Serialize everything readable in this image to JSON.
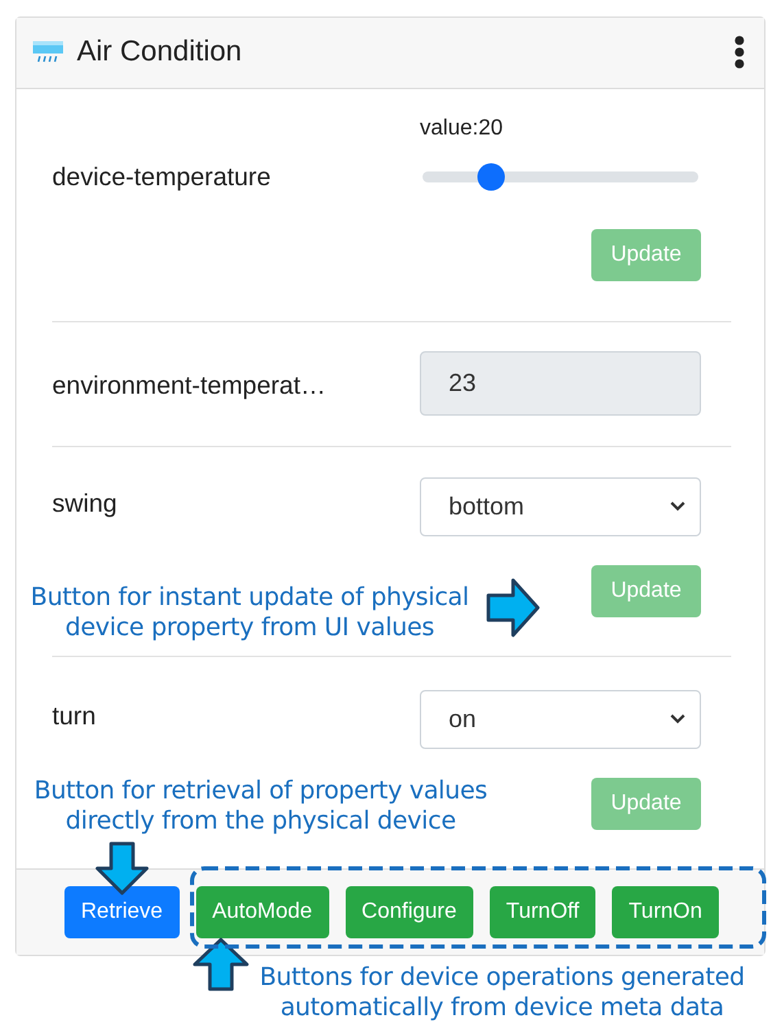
{
  "card": {
    "title": "Air Condition"
  },
  "properties": [
    {
      "kind": "slider",
      "label": "device-temperature",
      "reading": "value:20",
      "level": 0.22,
      "update": {
        "label": "Update",
        "disabled": true
      }
    },
    {
      "kind": "readonly",
      "label": "environment-temperat…",
      "value": "23"
    },
    {
      "kind": "select",
      "label": "swing",
      "value": "bottom",
      "update": {
        "label": "Update",
        "disabled": true
      }
    },
    {
      "kind": "select",
      "label": "turn",
      "value": "on",
      "update": {
        "label": "Update",
        "disabled": true
      }
    }
  ],
  "actions": [
    {
      "kind": "retrieve",
      "label": "Retrieve"
    },
    {
      "kind": "operation",
      "label": "AutoMode"
    },
    {
      "kind": "operation",
      "label": "Configure"
    },
    {
      "kind": "operation",
      "label": "TurnOff"
    },
    {
      "kind": "operation",
      "label": "TurnOn"
    }
  ],
  "annotations": [
    {
      "text": "Button for instant update of physical\ndevice property from UI values"
    },
    {
      "text": "Button for retrieval of property values\ndirectly from the physical device"
    },
    {
      "text": "Buttons for device operations generated\nautomatically from device meta data"
    }
  ]
}
